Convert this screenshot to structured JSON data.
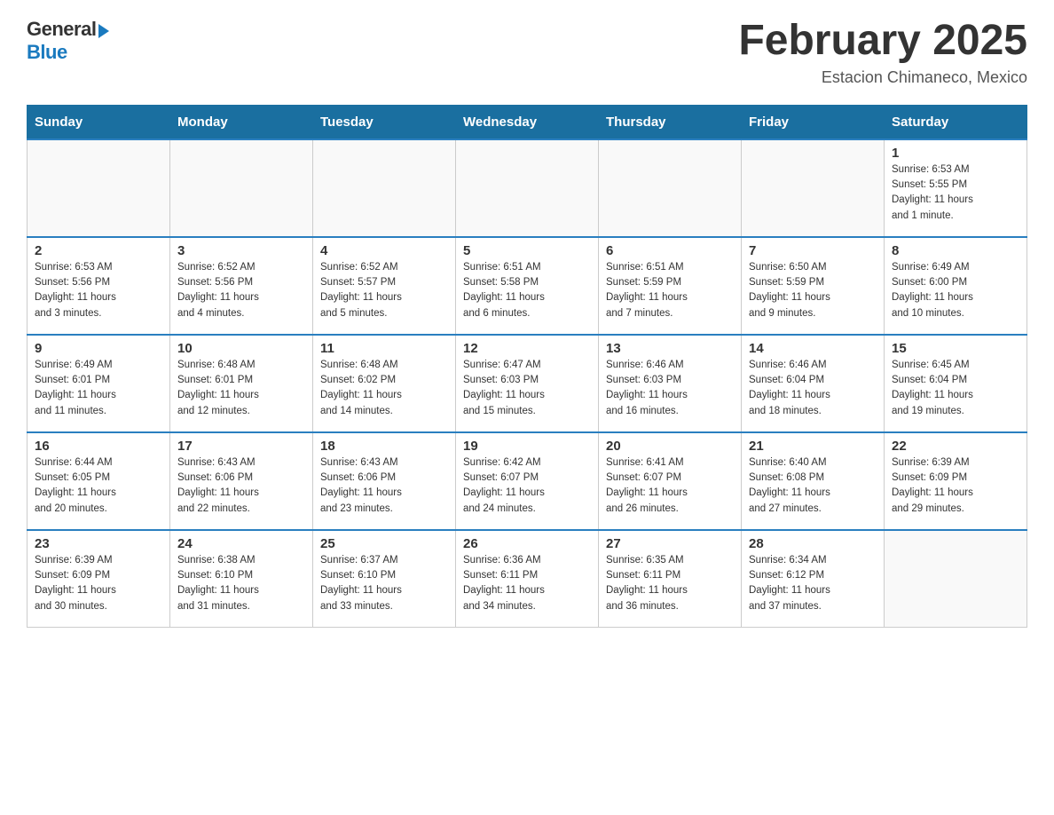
{
  "logo": {
    "general": "General",
    "blue": "Blue",
    "arrow": "▲"
  },
  "header": {
    "month_title": "February 2025",
    "location": "Estacion Chimaneco, Mexico"
  },
  "days_of_week": [
    "Sunday",
    "Monday",
    "Tuesday",
    "Wednesday",
    "Thursday",
    "Friday",
    "Saturday"
  ],
  "weeks": [
    [
      {
        "day": "",
        "info": ""
      },
      {
        "day": "",
        "info": ""
      },
      {
        "day": "",
        "info": ""
      },
      {
        "day": "",
        "info": ""
      },
      {
        "day": "",
        "info": ""
      },
      {
        "day": "",
        "info": ""
      },
      {
        "day": "1",
        "info": "Sunrise: 6:53 AM\nSunset: 5:55 PM\nDaylight: 11 hours\nand 1 minute."
      }
    ],
    [
      {
        "day": "2",
        "info": "Sunrise: 6:53 AM\nSunset: 5:56 PM\nDaylight: 11 hours\nand 3 minutes."
      },
      {
        "day": "3",
        "info": "Sunrise: 6:52 AM\nSunset: 5:56 PM\nDaylight: 11 hours\nand 4 minutes."
      },
      {
        "day": "4",
        "info": "Sunrise: 6:52 AM\nSunset: 5:57 PM\nDaylight: 11 hours\nand 5 minutes."
      },
      {
        "day": "5",
        "info": "Sunrise: 6:51 AM\nSunset: 5:58 PM\nDaylight: 11 hours\nand 6 minutes."
      },
      {
        "day": "6",
        "info": "Sunrise: 6:51 AM\nSunset: 5:59 PM\nDaylight: 11 hours\nand 7 minutes."
      },
      {
        "day": "7",
        "info": "Sunrise: 6:50 AM\nSunset: 5:59 PM\nDaylight: 11 hours\nand 9 minutes."
      },
      {
        "day": "8",
        "info": "Sunrise: 6:49 AM\nSunset: 6:00 PM\nDaylight: 11 hours\nand 10 minutes."
      }
    ],
    [
      {
        "day": "9",
        "info": "Sunrise: 6:49 AM\nSunset: 6:01 PM\nDaylight: 11 hours\nand 11 minutes."
      },
      {
        "day": "10",
        "info": "Sunrise: 6:48 AM\nSunset: 6:01 PM\nDaylight: 11 hours\nand 12 minutes."
      },
      {
        "day": "11",
        "info": "Sunrise: 6:48 AM\nSunset: 6:02 PM\nDaylight: 11 hours\nand 14 minutes."
      },
      {
        "day": "12",
        "info": "Sunrise: 6:47 AM\nSunset: 6:03 PM\nDaylight: 11 hours\nand 15 minutes."
      },
      {
        "day": "13",
        "info": "Sunrise: 6:46 AM\nSunset: 6:03 PM\nDaylight: 11 hours\nand 16 minutes."
      },
      {
        "day": "14",
        "info": "Sunrise: 6:46 AM\nSunset: 6:04 PM\nDaylight: 11 hours\nand 18 minutes."
      },
      {
        "day": "15",
        "info": "Sunrise: 6:45 AM\nSunset: 6:04 PM\nDaylight: 11 hours\nand 19 minutes."
      }
    ],
    [
      {
        "day": "16",
        "info": "Sunrise: 6:44 AM\nSunset: 6:05 PM\nDaylight: 11 hours\nand 20 minutes."
      },
      {
        "day": "17",
        "info": "Sunrise: 6:43 AM\nSunset: 6:06 PM\nDaylight: 11 hours\nand 22 minutes."
      },
      {
        "day": "18",
        "info": "Sunrise: 6:43 AM\nSunset: 6:06 PM\nDaylight: 11 hours\nand 23 minutes."
      },
      {
        "day": "19",
        "info": "Sunrise: 6:42 AM\nSunset: 6:07 PM\nDaylight: 11 hours\nand 24 minutes."
      },
      {
        "day": "20",
        "info": "Sunrise: 6:41 AM\nSunset: 6:07 PM\nDaylight: 11 hours\nand 26 minutes."
      },
      {
        "day": "21",
        "info": "Sunrise: 6:40 AM\nSunset: 6:08 PM\nDaylight: 11 hours\nand 27 minutes."
      },
      {
        "day": "22",
        "info": "Sunrise: 6:39 AM\nSunset: 6:09 PM\nDaylight: 11 hours\nand 29 minutes."
      }
    ],
    [
      {
        "day": "23",
        "info": "Sunrise: 6:39 AM\nSunset: 6:09 PM\nDaylight: 11 hours\nand 30 minutes."
      },
      {
        "day": "24",
        "info": "Sunrise: 6:38 AM\nSunset: 6:10 PM\nDaylight: 11 hours\nand 31 minutes."
      },
      {
        "day": "25",
        "info": "Sunrise: 6:37 AM\nSunset: 6:10 PM\nDaylight: 11 hours\nand 33 minutes."
      },
      {
        "day": "26",
        "info": "Sunrise: 6:36 AM\nSunset: 6:11 PM\nDaylight: 11 hours\nand 34 minutes."
      },
      {
        "day": "27",
        "info": "Sunrise: 6:35 AM\nSunset: 6:11 PM\nDaylight: 11 hours\nand 36 minutes."
      },
      {
        "day": "28",
        "info": "Sunrise: 6:34 AM\nSunset: 6:12 PM\nDaylight: 11 hours\nand 37 minutes."
      },
      {
        "day": "",
        "info": ""
      }
    ]
  ]
}
